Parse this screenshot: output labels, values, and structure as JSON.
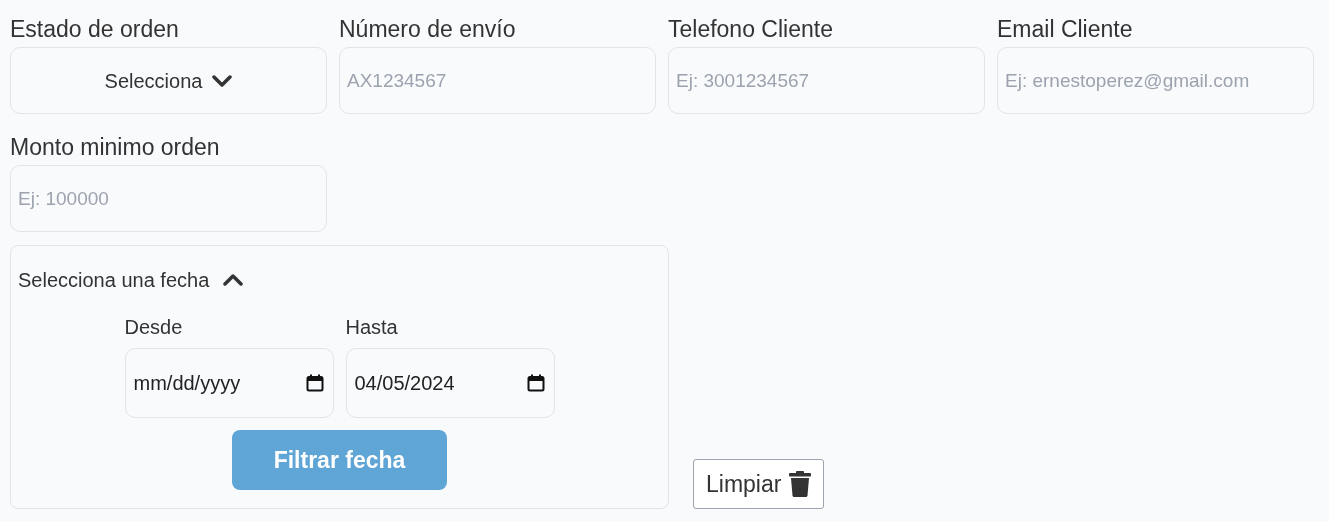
{
  "filters": [
    {
      "kind": "select",
      "label": "Estado de orden",
      "value": "Selecciona"
    },
    {
      "kind": "text",
      "label": "Número de envío",
      "placeholder": "AX1234567"
    },
    {
      "kind": "text",
      "label": "Telefono Cliente",
      "placeholder": "Ej: 3001234567"
    },
    {
      "kind": "text",
      "label": "Email Cliente",
      "placeholder": "Ej: ernestoperez@gmail.com"
    },
    {
      "kind": "text",
      "label": "Monto minimo orden",
      "placeholder": "Ej: 100000"
    }
  ],
  "date_filter": {
    "title": "Selecciona una fecha",
    "expanded": true,
    "from": {
      "label": "Desde",
      "placeholder": "mm/dd/yyyy"
    },
    "to": {
      "label": "Hasta",
      "value": "04/05/2024"
    },
    "apply_button": "Filtrar fecha"
  },
  "clear_button": "Limpiar"
}
